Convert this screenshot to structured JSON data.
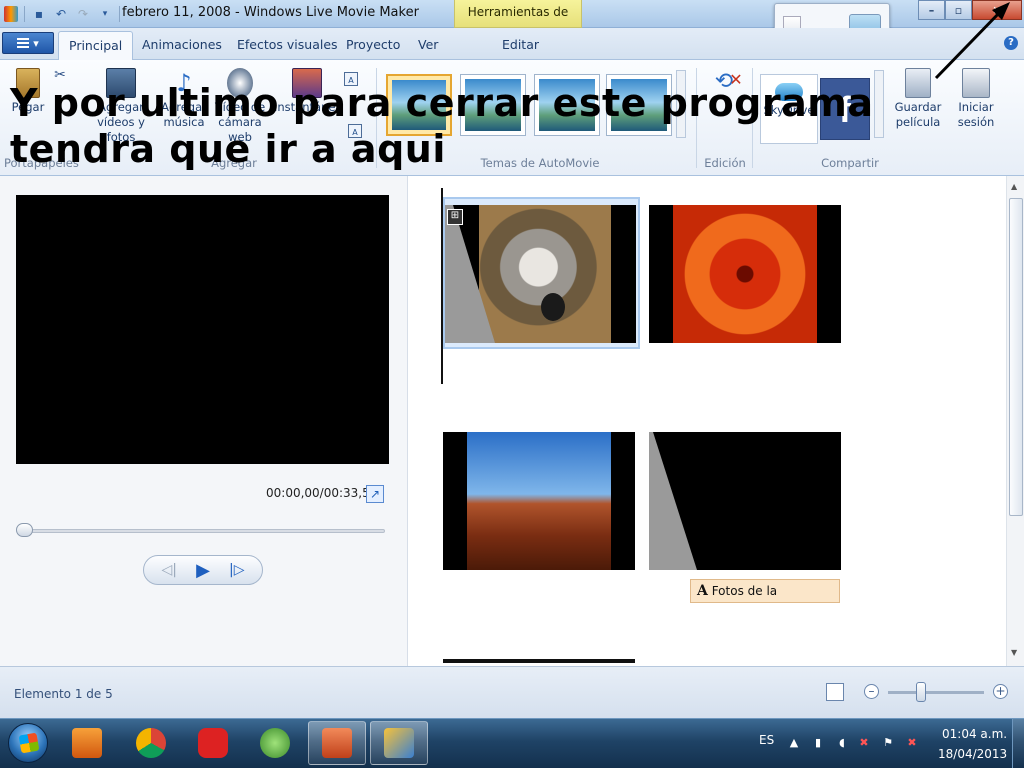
{
  "window": {
    "title": "febrero 11, 2008 - Windows Live Movie Maker",
    "contextual_tab_group": "Herramientas de vídeo",
    "controls": {
      "minimize": "–",
      "maximize": "▫",
      "close": "✕"
    }
  },
  "overlay_caption": "Y por ultimo para cerrar este programa tendra que  ir a aqui",
  "tabs": [
    {
      "label": "Principal",
      "active": true
    },
    {
      "label": "Animaciones"
    },
    {
      "label": "Efectos visuales"
    },
    {
      "label": "Proyecto"
    },
    {
      "label": "Ver"
    },
    {
      "label": "Editar"
    }
  ],
  "ribbon": {
    "paste": "Pegar",
    "add_videos": [
      "Agregar",
      "vídeos y fotos"
    ],
    "add_music": [
      "Agregar",
      "música"
    ],
    "webcam_video": [
      "Vídeo de",
      "cámara web"
    ],
    "snapshot": "Instantánea",
    "group_clipboard": "Portapapeles",
    "group_add": "Agregar",
    "group_themes": "Temas de AutoMovie",
    "group_edit": "Edición",
    "group_share": "Compartir",
    "skydrive": "SkyDrive",
    "save_movie": [
      "Guardar",
      "película"
    ],
    "sign_in": [
      "Iniciar",
      "sesión"
    ]
  },
  "preview": {
    "timecode": "00:00,00/00:33,50"
  },
  "storyboard": {
    "caption_chip": "Fotos de la",
    "caption_icon": "A"
  },
  "status": {
    "text": "Elemento 1 de 5"
  },
  "taskbar": {
    "language": "ES",
    "time": "01:04 a.m.",
    "date": "18/04/2013"
  },
  "colors": {
    "accent_blue": "#1e5fbf",
    "close_red": "#c84a31",
    "contextual_yellow": "#e6e07a",
    "selected_theme": "#e5a631"
  }
}
